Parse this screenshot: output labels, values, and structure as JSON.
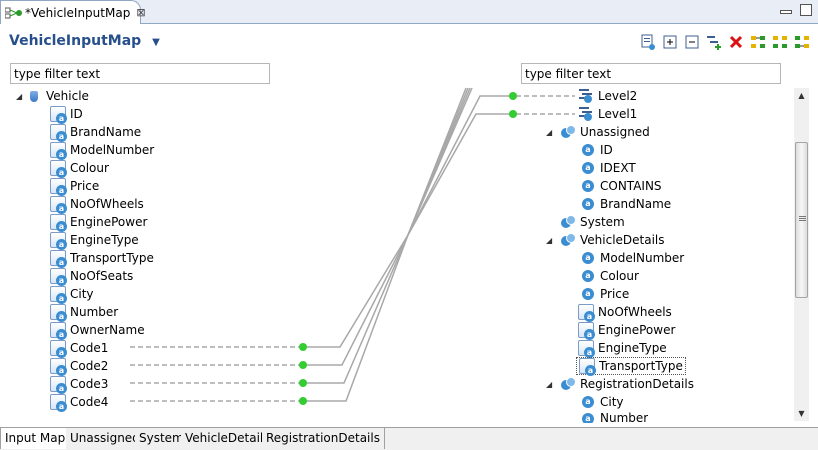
{
  "editor_tab": {
    "title": "*VehicleInputMap",
    "close_glyph": "⊠"
  },
  "header": {
    "title": "VehicleInputMap",
    "caret": "▼"
  },
  "toolbar": {
    "icons": [
      "add-mapping-icon",
      "expand-all-icon",
      "collapse-all-icon",
      "add-child-icon",
      "delete-icon",
      "layout-icon",
      "layout-two-icon",
      "layout-three-icon"
    ]
  },
  "filters": {
    "left_value": "type filter text",
    "right_value": "type filter text"
  },
  "left_tree": {
    "root": {
      "label": "Vehicle",
      "expanded": true
    },
    "fields": [
      "ID",
      "BrandName",
      "ModelNumber",
      "Colour",
      "Price",
      "NoOfWheels",
      "EnginePower",
      "EngineType",
      "TransportType",
      "NoOfSeats",
      "City",
      "Number",
      "OwnerName",
      "Code1",
      "Code2",
      "Code3",
      "Code4"
    ]
  },
  "right_tree": {
    "levels": [
      "Level2",
      "Level1"
    ],
    "unassigned": {
      "label": "Unassigned",
      "children": [
        "ID",
        "IDEXT",
        "CONTAINS",
        "BrandName"
      ]
    },
    "system": {
      "label": "System"
    },
    "vehicle_details": {
      "label": "VehicleDetails",
      "children": [
        "ModelNumber",
        "Colour",
        "Price",
        "NoOfWheels",
        "EnginePower",
        "EngineType",
        "TransportType"
      ]
    },
    "registration_details": {
      "label": "RegistrationDetails",
      "children": [
        "City",
        "Number"
      ]
    }
  },
  "bottom_tabs": [
    "Input Map",
    "Unassigned",
    "System",
    "VehicleDetails",
    "RegistrationDetails"
  ],
  "colors": {
    "accent": "#274f8c",
    "connector_dot": "#33cc33",
    "connector_line": "#a8a8a8"
  }
}
